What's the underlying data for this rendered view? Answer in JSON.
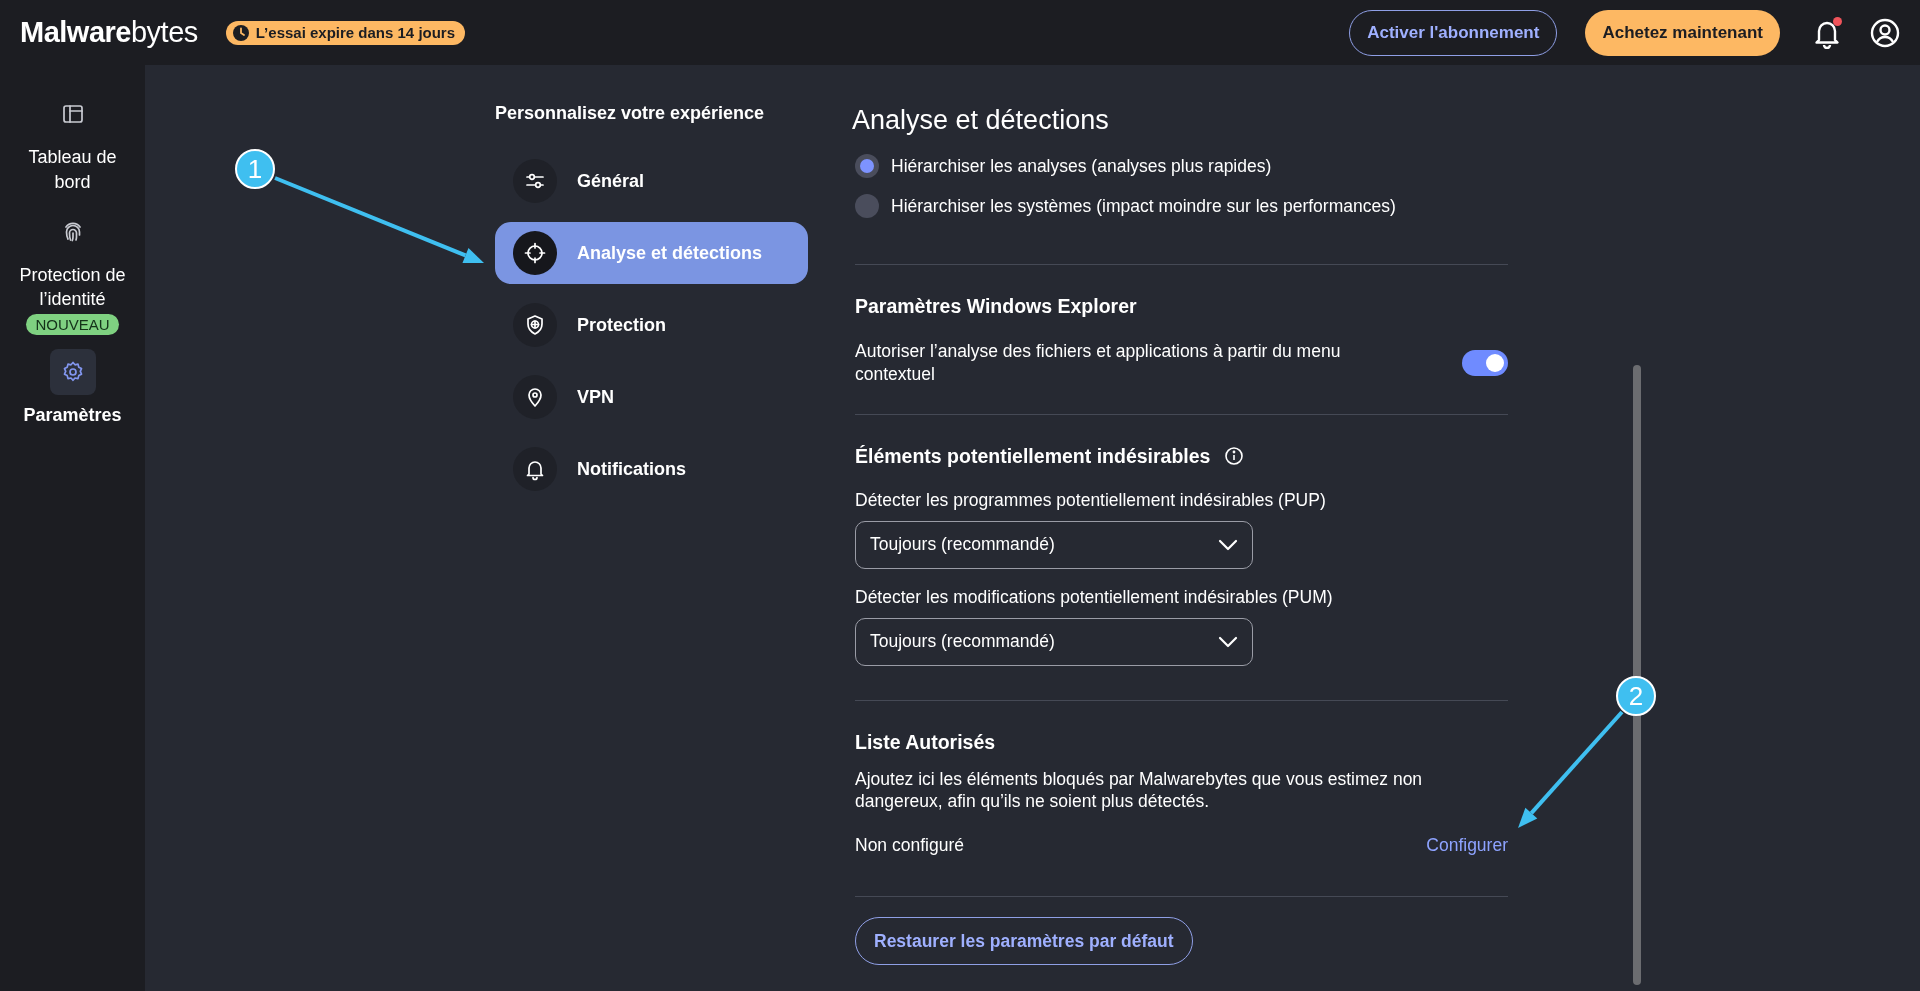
{
  "topbar": {
    "logo": "**Malware**bytes",
    "trial_badge": "L’essai expire dans 14 jours",
    "buttons": [
      {
        "label": "Activer l'abonnement",
        "kind": "outline"
      },
      {
        "label": "Achetez maintenant",
        "kind": "primary"
      }
    ],
    "notifications": {
      "unread": true
    }
  },
  "sidebar": {
    "items": [
      {
        "label": "Tableau de bord",
        "kind": "dashboard",
        "selected": false
      },
      {
        "label": "Protection de l’identité",
        "kind": "fingerprint",
        "badge": "NOUVEAU",
        "selected": false
      },
      {
        "label": "Paramètres",
        "kind": "gear",
        "selected": true
      }
    ]
  },
  "settings_nav": {
    "title": "Personnalisez votre expérience",
    "items": [
      {
        "label": "Général",
        "kind": "sliders",
        "selected": false
      },
      {
        "label": "Analyse et détections",
        "kind": "crosshair",
        "selected": true
      },
      {
        "label": "Protection",
        "kind": "shield",
        "selected": false
      },
      {
        "label": "VPN",
        "kind": "pin",
        "selected": false
      },
      {
        "label": "Notifications",
        "kind": "bell",
        "selected": false
      }
    ]
  },
  "content": {
    "title": "Analyse et détections",
    "sections": [
      {
        "kind": "radios",
        "options": [
          {
            "label": "Hiérarchiser les analyses (analyses plus rapides)",
            "selected": true
          },
          {
            "label": "Hiérarchiser les systèmes (impact moindre sur les performances)",
            "selected": false
          }
        ]
      },
      {
        "kind": "toggle",
        "title": "Paramètres Windows Explorer",
        "label": "Autoriser l’analyse des fichiers et applications à partir du menu contextuel",
        "on": true
      },
      {
        "kind": "selects",
        "title": "Éléments potentiellement indésirables",
        "info": true,
        "fields": [
          {
            "label": "Détecter les programmes potentiellement indésirables (PUP)",
            "value": "Toujours (recommandé)"
          },
          {
            "label": "Détecter les modifications potentiellement indésirables (PUM)",
            "value": "Toujours (recommandé)"
          }
        ]
      },
      {
        "kind": "allowlist",
        "title": "Liste Autorisés",
        "description": "Ajoutez ici les éléments bloqués par Malwarebytes que vous estimez non dangereux, afin qu’ils ne soient plus détectés.",
        "status": "Non configuré",
        "link": "Configurer"
      }
    ],
    "reset_button": "Restaurer les paramètres par défaut"
  },
  "annotations": [
    {
      "label": "1"
    },
    {
      "label": "2"
    }
  ]
}
